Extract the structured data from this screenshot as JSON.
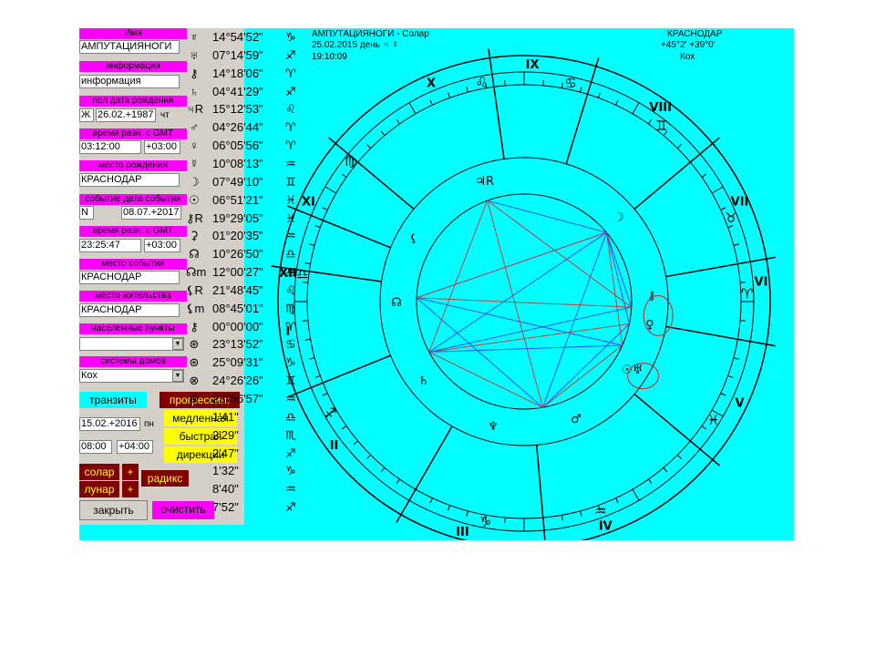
{
  "left_panel": {
    "name_label": "Имя",
    "name_value": "АМПУТАЦИЯНОГИ",
    "info_label": "информация",
    "info_value": "информация",
    "birth_label": "пол  дата рождения",
    "gender": "Ж",
    "birth_date": "26.02.+1987",
    "birth_weekday": "чт",
    "time_label": "время    разн. с GMT",
    "birth_time": "03:12:00",
    "birth_gmt": "+03:00",
    "birthplace_label": "место рождения",
    "birthplace": "КРАСНОДАР",
    "event_label": "событие  дата события",
    "event_flag": "N",
    "event_date": "08.07.+2017",
    "event_time_label": "время    разн. с GMT",
    "event_time": "23:25:47",
    "event_gmt": "+03:00",
    "eventplace_label": "место события",
    "eventplace": "КРАСНОДАР",
    "residence_label": "место жительства",
    "residence": "КРАСНОДАР",
    "settlements_label": "населенные пункты",
    "settlements_value": "",
    "houses_label": "системы домов",
    "houses_value": "Кох",
    "transits": "транзиты",
    "progressions": "прогрессии:",
    "slow": "медленная",
    "fast": "быстрая",
    "directions": "дирекции",
    "trans_date": "15.02.+2016",
    "trans_weekday": "пн",
    "trans_time": "08:00",
    "trans_gmt": "+04:00",
    "solar": "солар",
    "lunar": "лунар",
    "plus": "+",
    "radix": "радикс",
    "close": "закрыть",
    "clear": "очистить",
    "dropdown_arrow": "▼"
  },
  "planets": [
    {
      "glyph": "♆",
      "value": "14°54'52\"",
      "sign": "♑"
    },
    {
      "glyph": "♅",
      "value": "07°14'59\"",
      "sign": "♐"
    },
    {
      "glyph": "⚷",
      "value": "14°18'06\"",
      "sign": "♈"
    },
    {
      "glyph": "♄",
      "value": "04°41'29\"",
      "sign": "♐"
    },
    {
      "glyph": "♃R",
      "value": "15°12'53\"",
      "sign": "♌"
    },
    {
      "glyph": "♂",
      "value": "04°26'44\"",
      "sign": "♈"
    },
    {
      "glyph": "♀",
      "value": "06°05'56\"",
      "sign": "♈"
    },
    {
      "glyph": "☿",
      "value": "10°08'13\"",
      "sign": "♒"
    },
    {
      "glyph": "☽",
      "value": "07°49'10\"",
      "sign": "♊"
    },
    {
      "glyph": "☉",
      "value": "06°51'21\"",
      "sign": "♓"
    },
    {
      "glyph": "⚷R",
      "value": "19°29'05\"",
      "sign": "♓"
    },
    {
      "glyph": "⚳",
      "value": "01°20'35\"",
      "sign": "♒"
    },
    {
      "glyph": "☊",
      "value": "10°26'50\"",
      "sign": "♎"
    },
    {
      "glyph": "☊m",
      "value": "12°00'27\"",
      "sign": "♎"
    },
    {
      "glyph": "⚸R",
      "value": "21°48'45\"",
      "sign": "♌"
    },
    {
      "glyph": "⚸m",
      "value": "08°45'01\"",
      "sign": "♍"
    },
    {
      "glyph": "⚷",
      "value": "00°00'00\"",
      "sign": "♈"
    },
    {
      "glyph": "⊛",
      "value": "23°13'52\"",
      "sign": "♋"
    },
    {
      "glyph": "⊛",
      "value": "25°09'31\"",
      "sign": "♑"
    },
    {
      "glyph": "⊗",
      "value": "24°26'26\"",
      "sign": "♊"
    },
    {
      "glyph": "⊕",
      "value": "23°56'57\"",
      "sign": "♒"
    },
    {
      "glyph": "",
      "value": "1'41\"",
      "sign": "♎"
    },
    {
      "glyph": "",
      "value": "2'29\"",
      "sign": "♏"
    },
    {
      "glyph": "",
      "value": "2'47\"",
      "sign": "♐"
    },
    {
      "glyph": "",
      "value": "1'32\"",
      "sign": "♑"
    },
    {
      "glyph": "",
      "value": "8'40\"",
      "sign": "♒"
    },
    {
      "glyph": "",
      "value": "7'52\"",
      "sign": "♐"
    }
  ],
  "chart_header": {
    "title": "АМПУТАЦИЯНОГИ - Солар",
    "date_line": "25.02.2015 день ♃ ☿",
    "time": "19:10:09",
    "city": "КРАСНОДАР",
    "coords": "+45°2' +39°0'",
    "system": "Кох"
  },
  "chart": {
    "house_numerals": [
      "I",
      "II",
      "III",
      "IV",
      "V",
      "VI",
      "VII",
      "VIII",
      "IX",
      "X",
      "XI",
      "XII"
    ],
    "house_angles": [
      172,
      202,
      240,
      275,
      320,
      350,
      10,
      40,
      73,
      98,
      140,
      158
    ],
    "ring_signs": [
      {
        "glyph": "♌",
        "angle": 101
      },
      {
        "glyph": "♋",
        "angle": 78
      },
      {
        "glyph": "♊",
        "angle": 52
      },
      {
        "glyph": "♉",
        "angle": 22
      },
      {
        "glyph": "♈",
        "angle": 2
      },
      {
        "glyph": "♓",
        "angle": -32
      },
      {
        "glyph": "♒",
        "angle": -70
      },
      {
        "glyph": "♑",
        "angle": -100
      },
      {
        "glyph": "♐",
        "angle": -150
      },
      {
        "glyph": "♍",
        "angle": 141
      },
      {
        "glyph": "♎",
        "angle": 173
      }
    ],
    "inner_glyphs": [
      {
        "glyph": "♃",
        "sub": "R",
        "angle": 108
      },
      {
        "glyph": "☊",
        "angle": 180
      },
      {
        "glyph": "⚸",
        "angle": 150
      },
      {
        "glyph": "☽",
        "angle": 42
      },
      {
        "glyph": "♄",
        "angle": 218
      },
      {
        "glyph": "♆",
        "angle": 256
      },
      {
        "glyph": "♂",
        "angle": 294
      },
      {
        "glyph": "☉♅",
        "angle": 328
      },
      {
        "glyph": "♀",
        "angle": 350
      },
      {
        "glyph": "⚷",
        "angle": 3
      }
    ],
    "aspect_points": [
      {
        "id": "moon",
        "angle": 40
      },
      {
        "id": "venus",
        "angle": -3
      },
      {
        "id": "mars",
        "angle": -12
      },
      {
        "id": "sunura",
        "angle": -24
      },
      {
        "id": "neptune",
        "angle": -80
      },
      {
        "id": "saturn",
        "angle": -152
      },
      {
        "id": "node",
        "angle": 178
      },
      {
        "id": "jupiter",
        "angle": 110
      }
    ],
    "lines": [
      {
        "a": "moon",
        "b": "neptune",
        "color": "#3050ff"
      },
      {
        "a": "moon",
        "b": "saturn",
        "color": "#3050ff"
      },
      {
        "a": "moon",
        "b": "node",
        "color": "#3050ff"
      },
      {
        "a": "moon",
        "b": "venus",
        "color": "#3050ff"
      },
      {
        "a": "moon",
        "b": "mars",
        "color": "#3050ff"
      },
      {
        "a": "saturn",
        "b": "venus",
        "color": "#3050ff"
      },
      {
        "a": "saturn",
        "b": "sunura",
        "color": "#3050ff"
      },
      {
        "a": "node",
        "b": "neptune",
        "color": "#3050ff"
      },
      {
        "a": "node",
        "b": "sunura",
        "color": "#3050ff"
      },
      {
        "a": "neptune",
        "b": "mars",
        "color": "#3050ff"
      },
      {
        "a": "jupiter",
        "b": "moon",
        "color": "#3050ff"
      },
      {
        "a": "jupiter",
        "b": "neptune",
        "color": "#c04040"
      },
      {
        "a": "jupiter",
        "b": "venus",
        "color": "#c04040"
      },
      {
        "a": "jupiter",
        "b": "saturn",
        "color": "#c04040"
      },
      {
        "a": "node",
        "b": "moon",
        "color": "#c04040"
      },
      {
        "a": "saturn",
        "b": "mars",
        "color": "#c04040"
      },
      {
        "a": "node",
        "b": "venus",
        "color": "#c04040"
      },
      {
        "a": "neptune",
        "b": "sunura",
        "color": "#c04040"
      },
      {
        "a": "saturn",
        "b": "neptune",
        "color": "#c04040"
      },
      {
        "a": "moon",
        "b": "sunura",
        "color": "#c04040"
      }
    ],
    "colors": {
      "circle": "#000000",
      "blue": "#3050ff",
      "red": "#c04040",
      "background": "#00ffff"
    }
  }
}
